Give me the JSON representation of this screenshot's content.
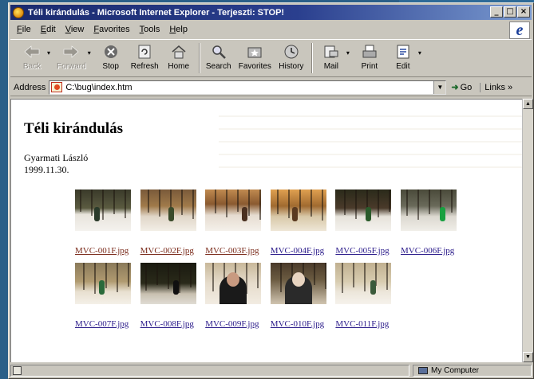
{
  "window": {
    "title": "Téli kirándulás - Microsoft Internet Explorer - Terjeszti: STOP!",
    "caption_buttons": [
      "_",
      "□",
      "×"
    ]
  },
  "menu": {
    "items": [
      "File",
      "Edit",
      "View",
      "Favorites",
      "Tools",
      "Help"
    ]
  },
  "toolbar": {
    "buttons": [
      {
        "label": "Back",
        "icon": "back-arrow-icon",
        "enabled": false
      },
      {
        "label": "Forward",
        "icon": "forward-arrow-icon",
        "enabled": false
      },
      {
        "label": "Stop",
        "icon": "stop-icon",
        "enabled": true
      },
      {
        "label": "Refresh",
        "icon": "refresh-icon",
        "enabled": true
      },
      {
        "label": "Home",
        "icon": "home-icon",
        "enabled": true
      },
      {
        "label": "Search",
        "icon": "search-icon",
        "enabled": true
      },
      {
        "label": "Favorites",
        "icon": "favorites-icon",
        "enabled": true
      },
      {
        "label": "History",
        "icon": "history-icon",
        "enabled": true
      },
      {
        "label": "Mail",
        "icon": "mail-icon",
        "enabled": true
      },
      {
        "label": "Print",
        "icon": "print-icon",
        "enabled": true
      },
      {
        "label": "Edit",
        "icon": "edit-icon",
        "enabled": true
      }
    ]
  },
  "address": {
    "label": "Address",
    "value": "C:\\bug\\index.htm",
    "go_label": "Go",
    "links_label": "Links »"
  },
  "page": {
    "title": "Téli kirándulás",
    "author": "Gyarmati László",
    "date": "1999.11.30.",
    "thumbnails": [
      {
        "file": "MVC-001F.jpg",
        "visited": true,
        "scene": "snowy-path"
      },
      {
        "file": "MVC-002F.jpg",
        "visited": true,
        "scene": "hillside"
      },
      {
        "file": "MVC-003F.jpg",
        "visited": true,
        "scene": "warm-forest"
      },
      {
        "file": "MVC-004F.jpg",
        "visited": false,
        "scene": "sunlit-forest"
      },
      {
        "file": "MVC-005F.jpg",
        "visited": false,
        "scene": "dark-forest"
      },
      {
        "file": "MVC-006F.jpg",
        "visited": false,
        "scene": "person-green"
      },
      {
        "file": "MVC-007F.jpg",
        "visited": false,
        "scene": "green-figure"
      },
      {
        "file": "MVC-008F.jpg",
        "visited": false,
        "scene": "dark-path"
      },
      {
        "file": "MVC-009F.jpg",
        "visited": false,
        "scene": "portrait-dark"
      },
      {
        "file": "MVC-010F.jpg",
        "visited": false,
        "scene": "portrait-hat"
      },
      {
        "file": "MVC-011F.jpg",
        "visited": false,
        "scene": "group-walk"
      }
    ]
  },
  "status": {
    "zone": "My Computer"
  },
  "colors": {
    "titlebar_start": "#1a2a6e",
    "link": "#2a1a8a",
    "visited_link": "#7a2a1a"
  }
}
